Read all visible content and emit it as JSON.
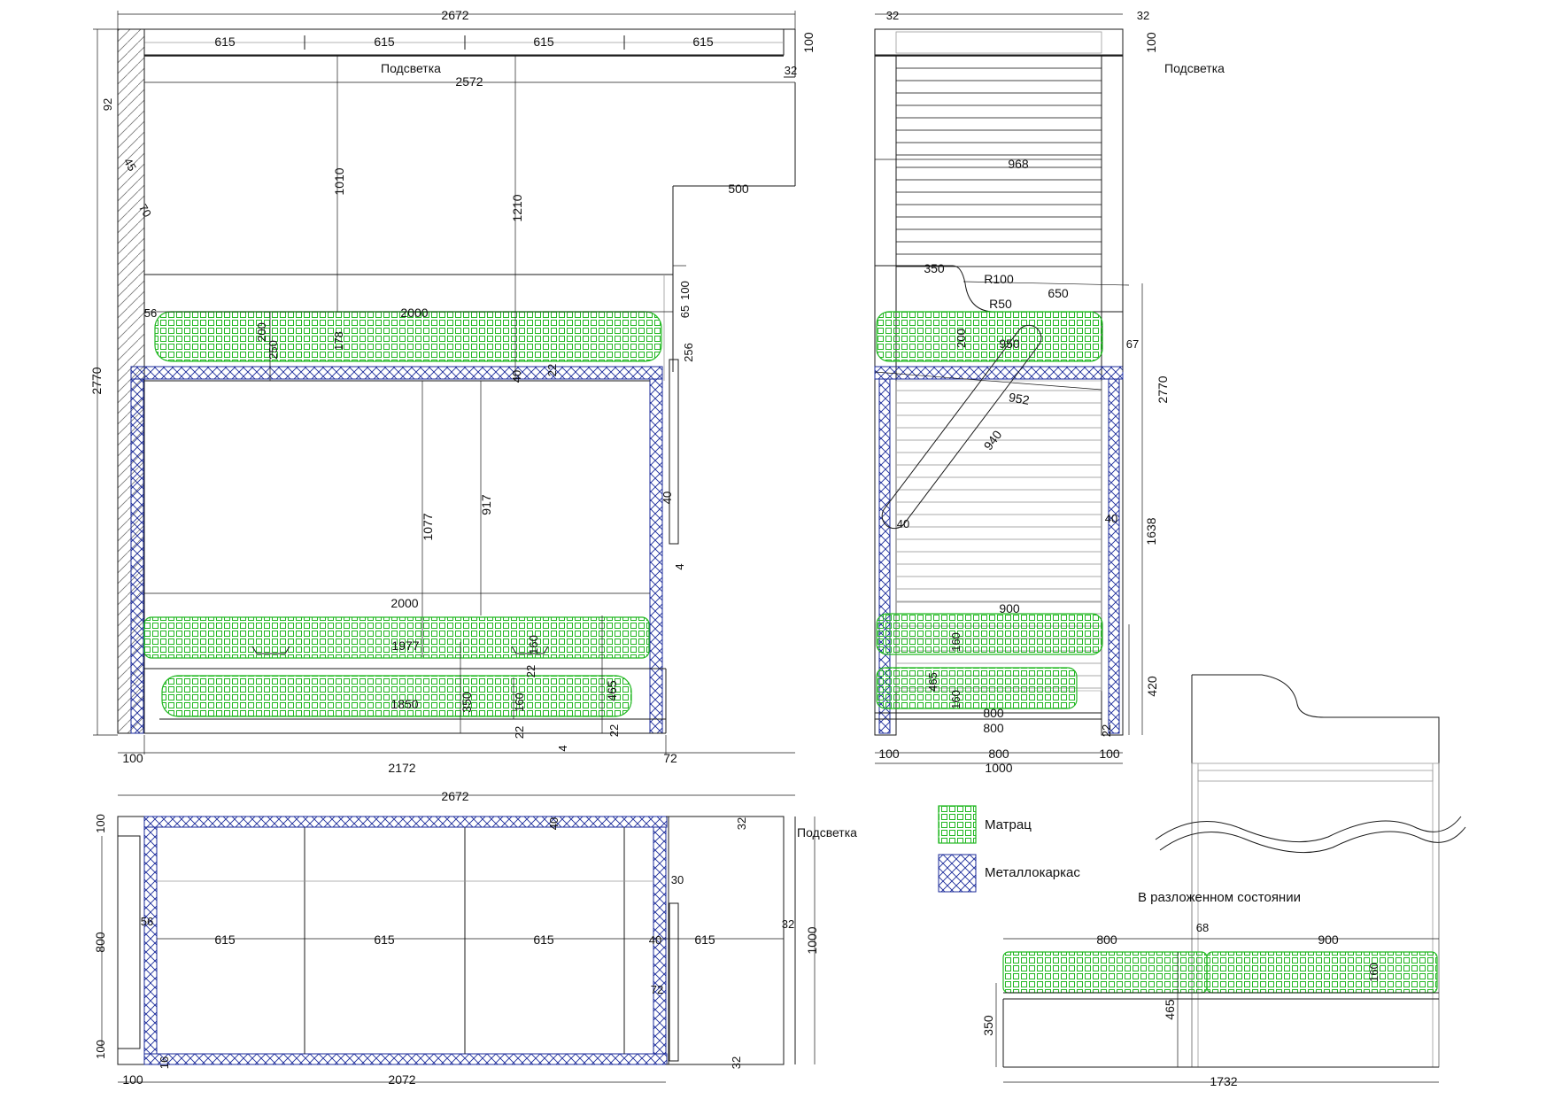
{
  "labels": {
    "backlight": "Подсветка",
    "legend_mattress": "Матрац",
    "legend_frame": "Металлокаркас",
    "unfolded": "В разложенном состоянии"
  },
  "colors": {
    "mattress": "#22b822",
    "frame": "#1a2a9a",
    "line": "#1a1a1a"
  },
  "dims": {
    "f_2672": "2672",
    "f_615a": "615",
    "f_615b": "615",
    "f_615c": "615",
    "f_615d": "615",
    "f_100t": "100",
    "f_32": "32",
    "f_2572": "2572",
    "f_92": "92",
    "f_45": "45",
    "f_70": "70",
    "f_1010": "1010",
    "f_1210": "1210",
    "f_500": "500",
    "f_100r": "100",
    "f_65": "65",
    "f_56": "56",
    "f_2000t": "2000",
    "f_200": "200",
    "f_250": "250",
    "f_178": "178",
    "f_256": "256",
    "f_40a": "40",
    "f_22a": "22",
    "f_2770": "2770",
    "f_1077": "1077",
    "f_917": "917",
    "f_40b": "40",
    "f_4": "4",
    "f_2000b": "2000",
    "f_1977": "1977",
    "f_160a": "160",
    "f_22b": "22",
    "f_1850": "1850",
    "f_350": "350",
    "f_160b": "160",
    "f_22c": "22",
    "f_465": "465",
    "f_22d": "22",
    "f_4b": "4",
    "f_100b": "100",
    "f_2172": "2172",
    "f_72": "72",
    "s_32a": "32",
    "s_32b": "32",
    "s_100": "100",
    "s_968": "968",
    "s_350": "350",
    "s_R100": "R100",
    "s_R50": "R50",
    "s_650": "650",
    "s_200": "200",
    "s_950": "950",
    "s_67": "67",
    "s_952": "952",
    "s_940": "940",
    "s_2770": "2770",
    "s_40a": "40",
    "s_40b": "40",
    "s_1638": "1638",
    "s_900": "900",
    "s_160a": "160",
    "s_465": "465",
    "s_160b": "160",
    "s_800a": "800",
    "s_800b": "800",
    "s_22": "22",
    "s_420": "420",
    "s_100l": "100",
    "s_800c": "800",
    "s_100r": "100",
    "s_1000": "1000",
    "p_2672": "2672",
    "p_100a": "100",
    "p_40": "40",
    "p_32a": "32",
    "p_800": "800",
    "p_56": "56",
    "p_615a": "615",
    "p_615b": "615",
    "p_615c": "615",
    "p_40b": "40",
    "p_615d": "615",
    "p_30": "30",
    "p_32b": "32",
    "p_1000": "1000",
    "p_72": "72",
    "p_100b": "100",
    "p_16": "16",
    "p_32c": "32",
    "p_100c": "100",
    "p_2072": "2072",
    "u_800": "800",
    "u_68": "68",
    "u_900": "900",
    "u_160": "160",
    "u_350": "350",
    "u_465": "465",
    "u_1732": "1732"
  }
}
